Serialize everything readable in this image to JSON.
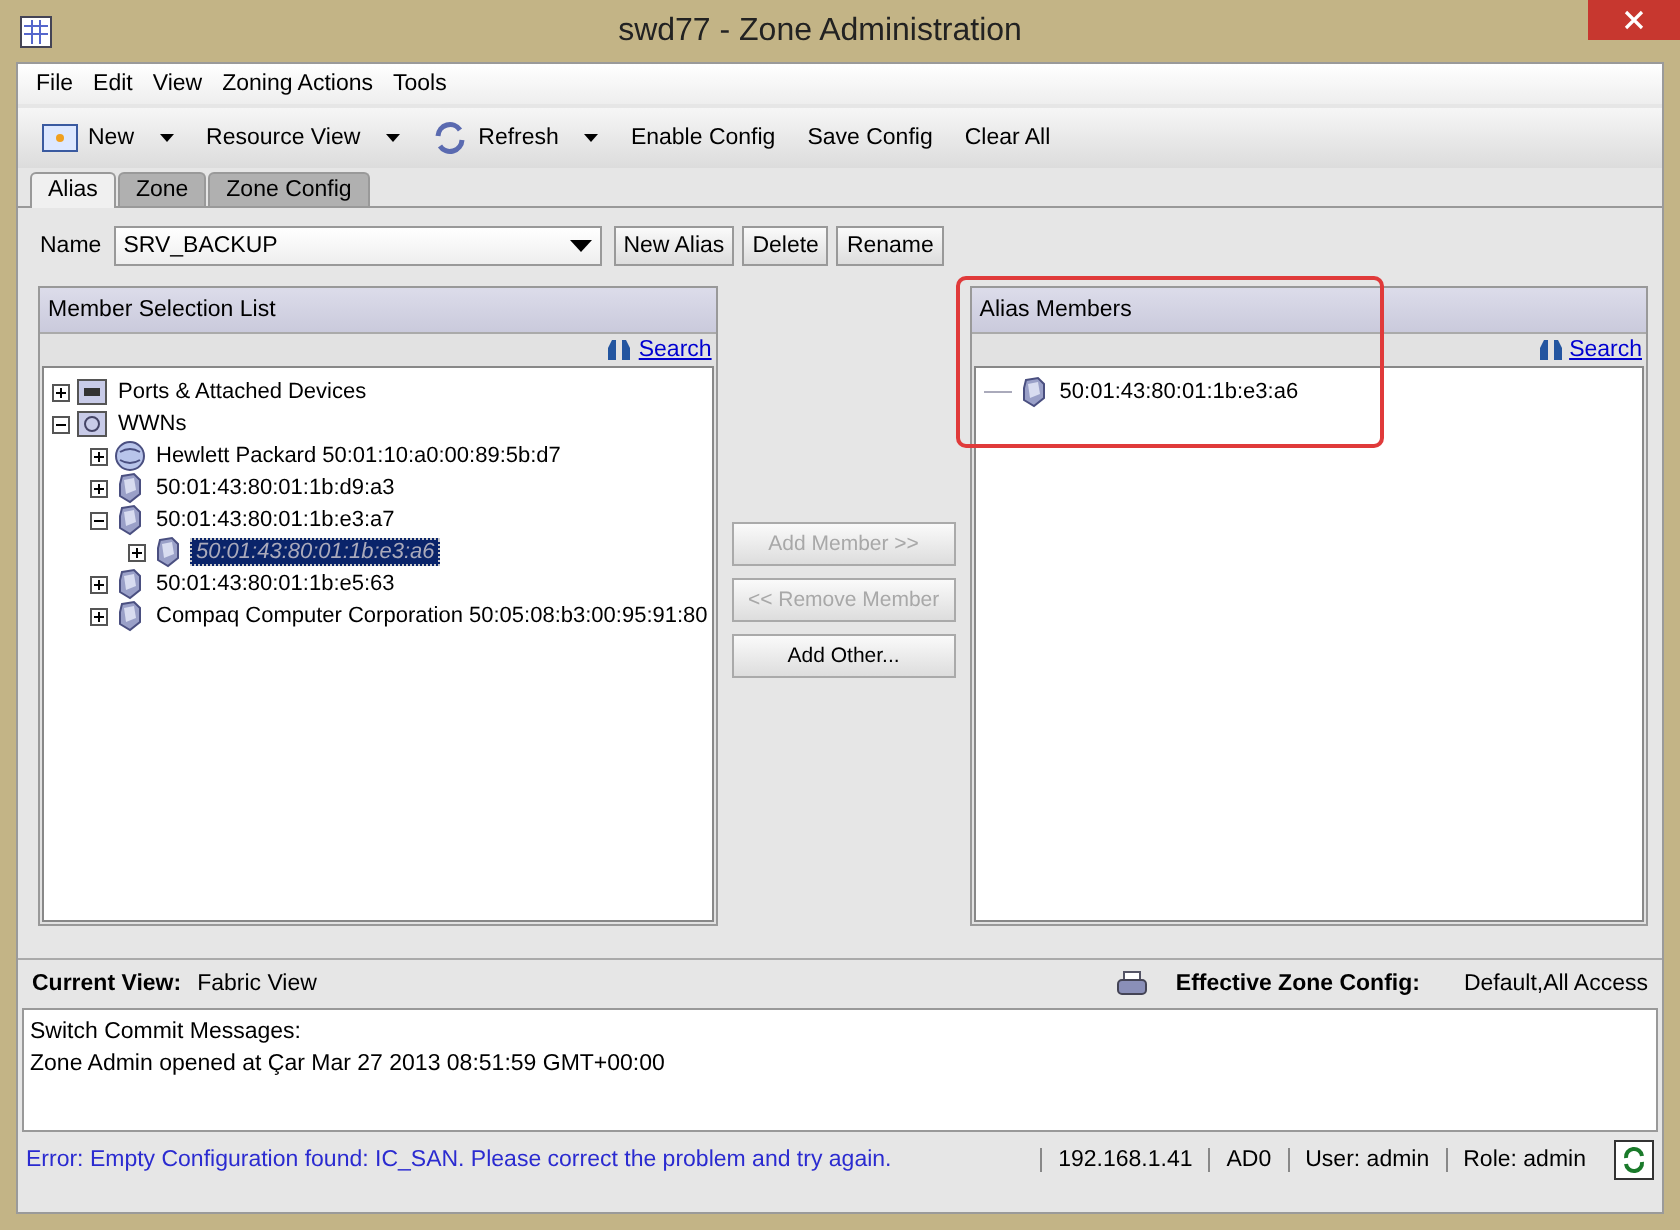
{
  "window": {
    "title": "swd77 - Zone Administration"
  },
  "menu": [
    "File",
    "Edit",
    "View",
    "Zoning Actions",
    "Tools"
  ],
  "toolbar": [
    {
      "label": "New",
      "kind": "new",
      "dropdown": true
    },
    {
      "label": "Resource View",
      "kind": "plain",
      "dropdown": true
    },
    {
      "label": "Refresh",
      "kind": "refresh",
      "dropdown": true
    },
    {
      "label": "Enable Config",
      "kind": "plain",
      "dropdown": false
    },
    {
      "label": "Save Config",
      "kind": "plain",
      "dropdown": false
    },
    {
      "label": "Clear All",
      "kind": "plain",
      "dropdown": false
    }
  ],
  "tabs": [
    {
      "label": "Alias",
      "selected": true
    },
    {
      "label": "Zone",
      "selected": false
    },
    {
      "label": "Zone Config",
      "selected": false
    }
  ],
  "name_row": {
    "label": "Name",
    "value": "SRV_BACKUP",
    "buttons": [
      "New Alias",
      "Delete",
      "Rename"
    ]
  },
  "member_list": {
    "title": "Member Selection List",
    "search": "Search",
    "tree": [
      {
        "label": "Ports & Attached Devices",
        "kind": "ports",
        "expanded": false,
        "selected": false
      },
      {
        "label": "WWNs",
        "kind": "wwns",
        "expanded": true,
        "selected": false,
        "children": [
          {
            "label": "Hewlett Packard 50:01:10:a0:00:89:5b:d7",
            "kind": "globe",
            "expanded": false,
            "selected": false
          },
          {
            "label": "50:01:43:80:01:1b:d9:a3",
            "kind": "host",
            "expanded": false,
            "selected": false
          },
          {
            "label": "50:01:43:80:01:1b:e3:a7",
            "kind": "host",
            "expanded": true,
            "selected": false,
            "children": [
              {
                "label": "50:01:43:80:01:1b:e3:a6",
                "kind": "host",
                "expanded": false,
                "selected": true
              }
            ]
          },
          {
            "label": "50:01:43:80:01:1b:e5:63",
            "kind": "host",
            "expanded": false,
            "selected": false
          },
          {
            "label": "Compaq Computer Corporation 50:05:08:b3:00:95:91:80",
            "kind": "host",
            "expanded": false,
            "selected": false
          }
        ]
      }
    ]
  },
  "actions": [
    {
      "label": "Add Member >>",
      "disabled": true
    },
    {
      "label": "<< Remove Member",
      "disabled": true
    },
    {
      "label": "Add Other...",
      "disabled": false
    }
  ],
  "alias_members": {
    "title": "Alias Members",
    "search": "Search",
    "highlighted": true,
    "items": [
      {
        "label": "50:01:43:80:01:1b:e3:a6",
        "kind": "host"
      }
    ]
  },
  "view_bar": {
    "current_view_label": "Current View:",
    "current_view": "Fabric View",
    "effective_label": "Effective Zone Config:",
    "effective": "Default,All Access"
  },
  "messages": [
    "Switch Commit Messages:",
    "Zone Admin opened at Çar Mar 27 2013 08:51:59 GMT+00:00"
  ],
  "status_bar": {
    "error": "Error: Empty Configuration found: IC_SAN. Please correct the problem and try again.",
    "fields": [
      "192.168.1.41",
      "AD0",
      "User: admin",
      "Role: admin"
    ]
  }
}
